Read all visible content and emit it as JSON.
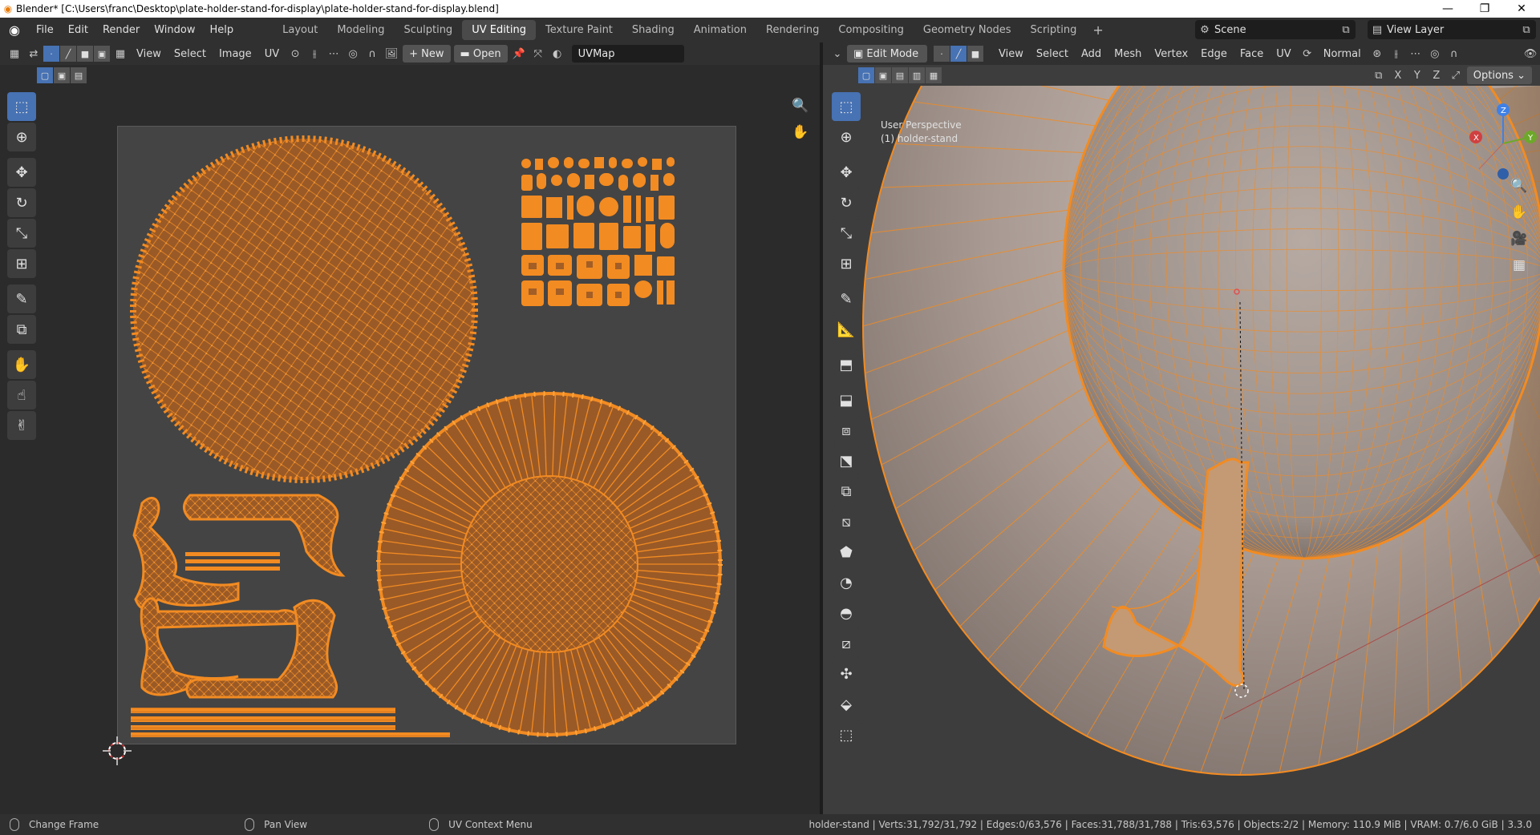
{
  "window": {
    "title": "Blender* [C:\\Users\\franc\\Desktop\\plate-holder-stand-for-display\\plate-holder-stand-for-display.blend]",
    "controls": [
      "—",
      "❐",
      "✕"
    ]
  },
  "menu": [
    "File",
    "Edit",
    "Render",
    "Window",
    "Help"
  ],
  "workspaces": [
    "Layout",
    "Modeling",
    "Sculpting",
    "UV Editing",
    "Texture Paint",
    "Shading",
    "Animation",
    "Rendering",
    "Compositing",
    "Geometry Nodes",
    "Scripting"
  ],
  "active_workspace": "UV Editing",
  "scene": "Scene",
  "view_layer": "View Layer",
  "uv_editor": {
    "menus": [
      "View",
      "Select",
      "Image",
      "UV"
    ],
    "new_label": "New",
    "open_label": "Open",
    "uvmap": "UVMap",
    "tools": [
      "select-box",
      "cursor",
      "move",
      "rotate",
      "scale",
      "transform",
      "annotate",
      "rip-region",
      "grab",
      "relax",
      "pinch"
    ]
  },
  "viewport": {
    "mode": "Edit Mode",
    "menus": [
      "View",
      "Select",
      "Add",
      "Mesh",
      "Vertex",
      "Edge",
      "Face",
      "UV"
    ],
    "orientation": "Normal",
    "options_label": "Options",
    "axis_labels": [
      "X",
      "Y",
      "Z"
    ],
    "perspective": "User Perspective",
    "object_label": "(1) holder-stand"
  },
  "status": {
    "left": "Change Frame",
    "middle": "Pan View",
    "right": "UV Context Menu",
    "stats": "holder-stand | Verts:31,792/31,792 | Edges:0/63,576 | Faces:31,788/31,788 | Tris:63,576 | Objects:2/2 | Memory: 110.9 MiB | VRAM: 0.7/6.0 GiB | 3.3.0"
  },
  "colors": {
    "accent": "#4772b3",
    "uv_orange": "#f28b22",
    "uv_fill": "#9a5a27",
    "mesh_surface": "#a89a92"
  }
}
